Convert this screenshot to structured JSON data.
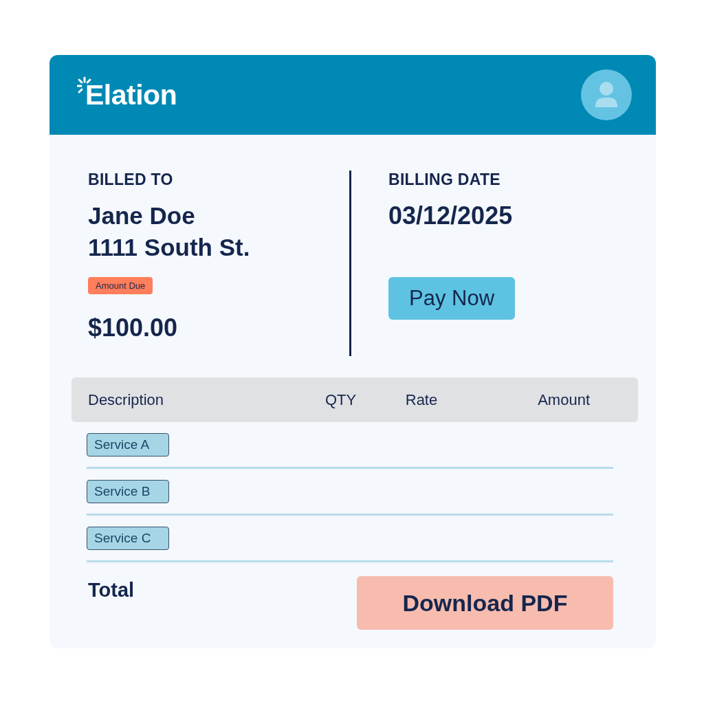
{
  "header": {
    "logo": "Elation"
  },
  "billed_to": {
    "label": "BILLED TO",
    "name": "Jane Doe",
    "address": "1111 South St.",
    "badge": "Amount Due",
    "amount": "$100.00"
  },
  "billing_date": {
    "label": "BILLING DATE",
    "date": "03/12/2025",
    "button": "Pay Now"
  },
  "table": {
    "columns": [
      "Description",
      "QTY",
      "Rate",
      "Amount"
    ],
    "rows": [
      {
        "description": "Service A"
      },
      {
        "description": "Service B"
      },
      {
        "description": "Service C"
      }
    ]
  },
  "footer": {
    "total_label": "Total",
    "button": "Download PDF"
  }
}
